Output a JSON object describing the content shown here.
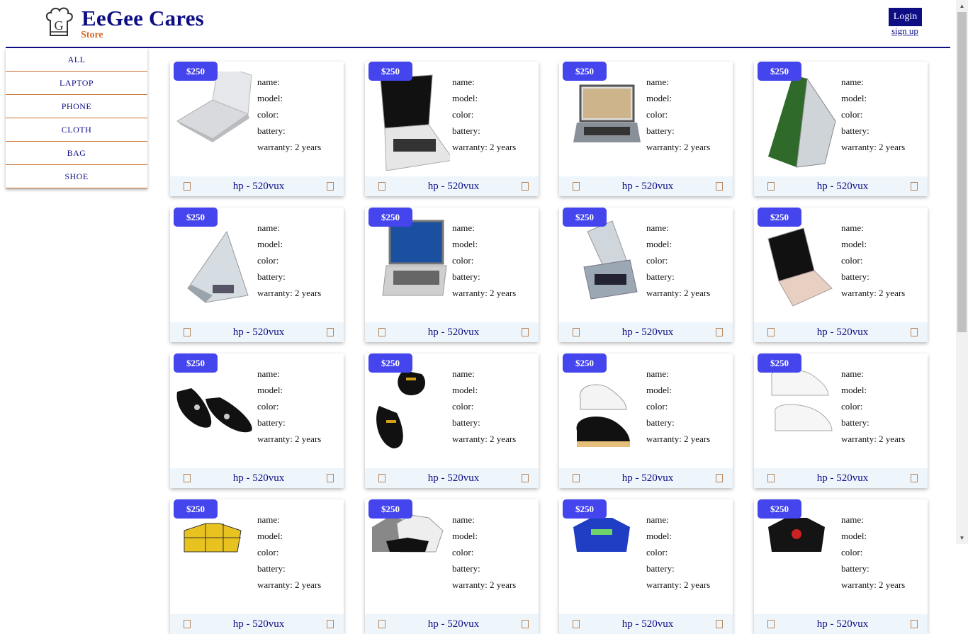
{
  "header": {
    "brand_name": "EeGee Cares",
    "brand_sub": "Store",
    "logo_letter": "G",
    "login_label": "Login",
    "signup_label": "sign up"
  },
  "sidebar": {
    "items": [
      {
        "label": "ALL"
      },
      {
        "label": "LAPTOP"
      },
      {
        "label": "PHONE"
      },
      {
        "label": "CLOTH"
      },
      {
        "label": "BAG"
      },
      {
        "label": "SHOE"
      }
    ]
  },
  "spec_labels": {
    "name": "name:",
    "model": "model:",
    "color": "color:",
    "battery": "battery:",
    "warranty": "warranty: 2 years"
  },
  "products": [
    {
      "price": "$250",
      "title": "hp - 520vux",
      "image": "laptop-silver-open"
    },
    {
      "price": "$250",
      "title": "hp - 520vux",
      "image": "laptop-macbook"
    },
    {
      "price": "$250",
      "title": "hp - 520vux",
      "image": "laptop-gray"
    },
    {
      "price": "$250",
      "title": "hp - 520vux",
      "image": "laptop-green-tent"
    },
    {
      "price": "$250",
      "title": "hp - 520vux",
      "image": "laptop-white-side"
    },
    {
      "price": "$250",
      "title": "hp - 520vux",
      "image": "laptop-windows"
    },
    {
      "price": "$250",
      "title": "hp - 520vux",
      "image": "laptop-convertible"
    },
    {
      "price": "$250",
      "title": "hp - 520vux",
      "image": "laptop-macbook-rose"
    },
    {
      "price": "$250",
      "title": "hp - 520vux",
      "image": "shoe-black-loafer"
    },
    {
      "price": "$250",
      "title": "hp - 520vux",
      "image": "shoe-black-loafer-gold"
    },
    {
      "price": "$250",
      "title": "hp - 520vux",
      "image": "sneaker-black-white"
    },
    {
      "price": "$250",
      "title": "hp - 520vux",
      "image": "sneaker-white"
    },
    {
      "price": "$250",
      "title": "hp - 520vux",
      "image": "shirt-yellow-plaid"
    },
    {
      "price": "$250",
      "title": "hp - 520vux",
      "image": "tshirt-pack"
    },
    {
      "price": "$250",
      "title": "hp - 520vux",
      "image": "tshirt-blue"
    },
    {
      "price": "$250",
      "title": "hp - 520vux",
      "image": "tshirt-black"
    }
  ],
  "colors": {
    "brand": "#0e0e84",
    "accent": "#d4692a",
    "price_badge": "#4545ee",
    "card_footer": "#eef6fc"
  }
}
